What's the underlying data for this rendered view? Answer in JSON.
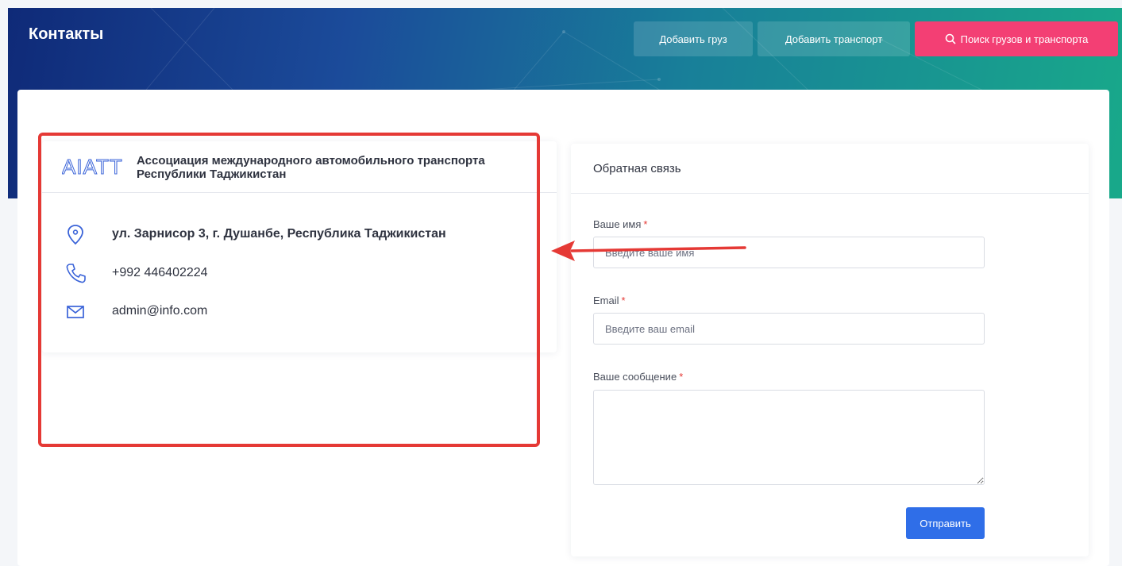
{
  "header": {
    "title": "Контакты",
    "buttons": {
      "add_cargo": "Добавить груз",
      "add_transport": "Добавить транспорт",
      "search": "Поиск грузов и транспорта"
    }
  },
  "contacts": {
    "logo_text": "AIATT",
    "organization": "Ассоциация международного автомобильного транспорта Республики Таджикистан",
    "address": "ул. Зарнисор 3, г. Душанбе, Республика Таджикистан",
    "phone": "+992 446402224",
    "email": "admin@info.com",
    "icons": [
      "map-pin-icon",
      "phone-icon",
      "mail-icon"
    ]
  },
  "feedback_form": {
    "title": "Обратная связь",
    "name_label": "Ваше имя",
    "name_placeholder": "Введите ваше имя",
    "email_label": "Email",
    "email_placeholder": "Введите ваш email",
    "message_label": "Ваше сообщение",
    "required_mark": "*",
    "submit_label": "Отправить"
  },
  "colors": {
    "search_button": "#f33f74",
    "submit_button": "#2f6ee8",
    "icon_blue": "#3a63d8",
    "annotation_red": "#e53935"
  }
}
